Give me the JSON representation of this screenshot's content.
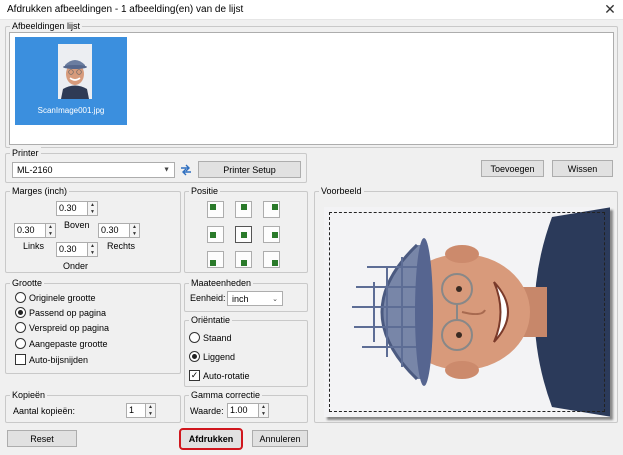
{
  "window": {
    "title": "Afdrukken afbeeldingen  -  1 afbeelding(en) van de lijst",
    "close_glyph": "✕"
  },
  "image_list": {
    "label": "Afbeeldingen lijst",
    "items": [
      {
        "filename": "ScanImage001.jpg",
        "selected": true
      }
    ]
  },
  "printer": {
    "label": "Printer",
    "selected": "ML-2160",
    "setup_button": "Printer Setup",
    "add_button": "Toevoegen",
    "remove_button": "Wissen"
  },
  "margins": {
    "label": "Marges (inch)",
    "top_label": "Boven",
    "top_value": "0.30",
    "left_label": "Links",
    "left_value": "0.30",
    "right_label": "Rechts",
    "right_value": "0.30",
    "bottom_label": "Onder",
    "bottom_value": "0.30"
  },
  "position": {
    "label": "Positie",
    "selected": "middle-center"
  },
  "size": {
    "label": "Grootte",
    "options": [
      "Originele grootte",
      "Passend op pagina",
      "Verspreid op pagina",
      "Aangepaste grootte"
    ],
    "selected_index": 1,
    "auto_crop_label": "Auto-bijsnijden",
    "auto_crop_checked": false
  },
  "units": {
    "label": "Maateenheden",
    "unit_label": "Eenheid:",
    "unit_value": "inch"
  },
  "orientation": {
    "label": "Oriëntatie",
    "portrait_label": "Staand",
    "landscape_label": "Liggend",
    "selected": "Liggend",
    "auto_rotate_label": "Auto-rotatie",
    "auto_rotate_checked": true
  },
  "copies": {
    "label": "Kopieën",
    "count_label": "Aantal kopieën:",
    "count_value": "1"
  },
  "gamma": {
    "label": "Gamma correctie",
    "value_label": "Waarde:",
    "value": "1.00"
  },
  "preview": {
    "label": "Voorbeeld"
  },
  "buttons": {
    "reset": "Reset",
    "print": "Afdrukken",
    "cancel": "Annuleren"
  },
  "icons": {
    "swap": "swap-arrows-icon",
    "dropdown": "chevron-down-icon",
    "check_mark": "✓"
  }
}
